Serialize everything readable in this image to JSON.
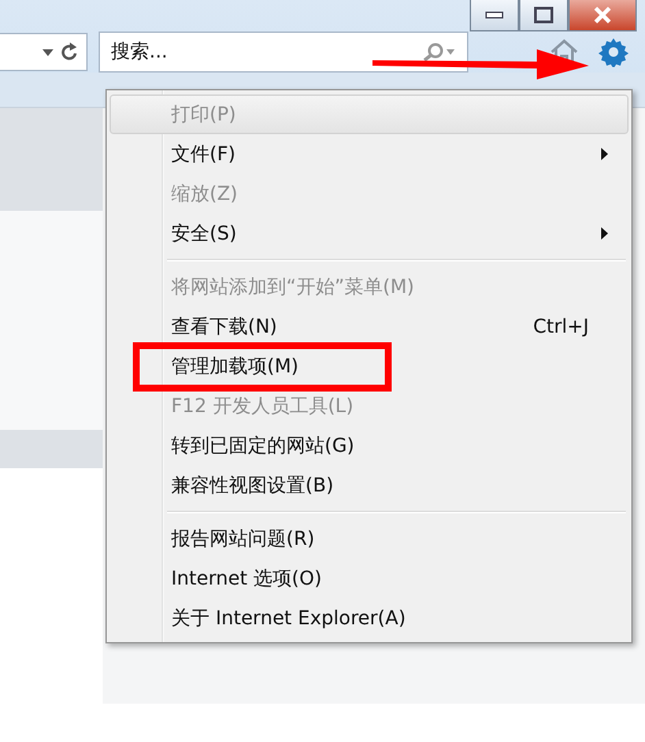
{
  "search": {
    "value": "搜索..."
  },
  "menu": {
    "items": [
      {
        "kind": "item",
        "label": "打印(P)",
        "disabled": true,
        "selected": true
      },
      {
        "kind": "item",
        "label": "文件(F)",
        "disabled": false,
        "selected": false,
        "submenu": true
      },
      {
        "kind": "item",
        "label": "缩放(Z)",
        "disabled": true,
        "selected": false
      },
      {
        "kind": "item",
        "label": "安全(S)",
        "disabled": false,
        "selected": false,
        "submenu": true
      },
      {
        "kind": "separator"
      },
      {
        "kind": "item",
        "label": "将网站添加到“开始”菜单(M)",
        "disabled": true,
        "selected": false
      },
      {
        "kind": "item",
        "label": "查看下载(N)",
        "disabled": false,
        "selected": false,
        "shortcut": "Ctrl+J"
      },
      {
        "kind": "item",
        "label": "管理加载项(M)",
        "disabled": false,
        "selected": false,
        "marked": true
      },
      {
        "kind": "item",
        "label": "F12 开发人员工具(L)",
        "disabled": true,
        "selected": false
      },
      {
        "kind": "item",
        "label": "转到已固定的网站(G)",
        "disabled": false,
        "selected": false
      },
      {
        "kind": "item",
        "label": "兼容性视图设置(B)",
        "disabled": false,
        "selected": false
      },
      {
        "kind": "separator"
      },
      {
        "kind": "item",
        "label": "报告网站问题(R)",
        "disabled": false,
        "selected": false
      },
      {
        "kind": "item",
        "label": "Internet 选项(O)",
        "disabled": false,
        "selected": false
      },
      {
        "kind": "item",
        "label": "关于 Internet Explorer(A)",
        "disabled": false,
        "selected": false
      }
    ]
  }
}
